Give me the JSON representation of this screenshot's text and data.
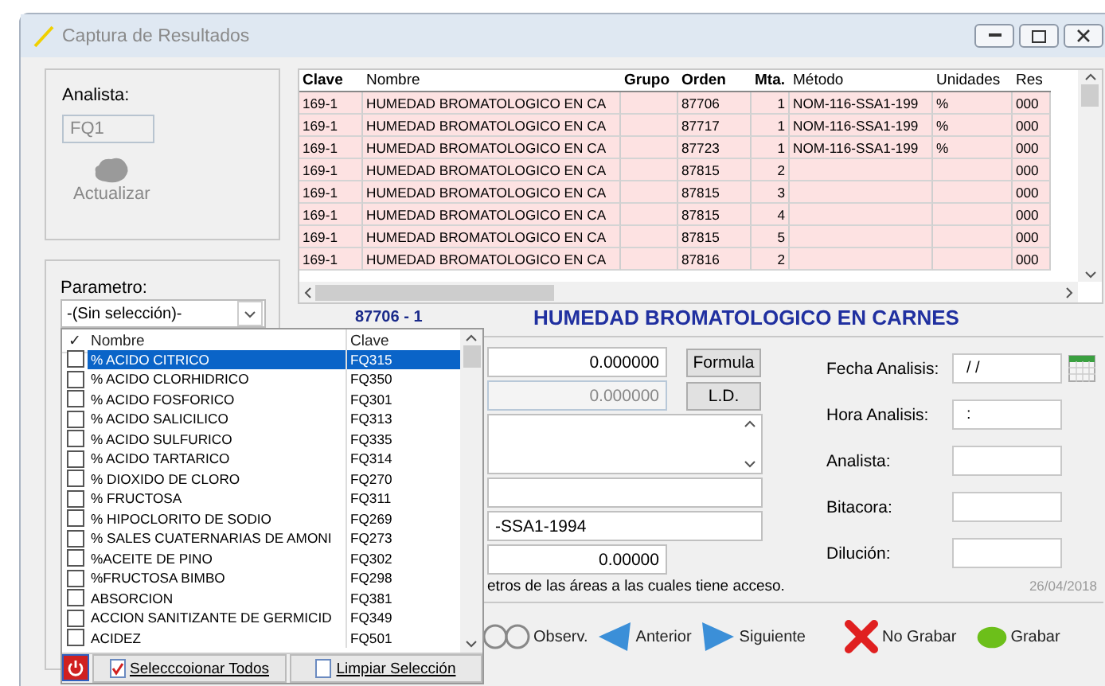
{
  "window": {
    "title": "Captura de Resultados"
  },
  "analista_panel": {
    "label": "Analista:",
    "value": "FQ1",
    "disabled": true,
    "refresh_label": "Actualizar",
    "refresh_disabled": true
  },
  "parametro_panel": {
    "label": "Parametro:",
    "value": "-(Sin selección)-"
  },
  "results_grid": {
    "columns": [
      "Clave",
      "Nombre",
      "Grupo",
      "Orden",
      "Mta.",
      "Método",
      "Unidades",
      "Res"
    ],
    "rows": [
      {
        "cells": [
          "169-1",
          "HUMEDAD BROMATOLOGICO EN CA",
          "",
          "87706",
          "1",
          "NOM-116-SSA1-199",
          "%",
          "000"
        ]
      },
      {
        "cells": [
          "169-1",
          "HUMEDAD BROMATOLOGICO EN CA",
          "",
          "87717",
          "1",
          "NOM-116-SSA1-199",
          "%",
          "000"
        ]
      },
      {
        "cells": [
          "169-1",
          "HUMEDAD BROMATOLOGICO EN CA",
          "",
          "87723",
          "1",
          "NOM-116-SSA1-199",
          "%",
          "000"
        ]
      },
      {
        "cells": [
          "169-1",
          "HUMEDAD BROMATOLOGICO EN CA",
          "",
          "87815",
          "2",
          "",
          "",
          "000"
        ]
      },
      {
        "cells": [
          "169-1",
          "HUMEDAD BROMATOLOGICO EN CA",
          "",
          "87815",
          "3",
          "",
          "",
          "000"
        ]
      },
      {
        "cells": [
          "169-1",
          "HUMEDAD BROMATOLOGICO EN CA",
          "",
          "87815",
          "4",
          "",
          "",
          "000"
        ]
      },
      {
        "cells": [
          "169-1",
          "HUMEDAD BROMATOLOGICO EN CA",
          "",
          "87815",
          "5",
          "",
          "",
          "000"
        ]
      },
      {
        "cells": [
          "169-1",
          "HUMEDAD BROMATOLOGICO EN CA",
          "",
          "87816",
          "2",
          "",
          "",
          "000"
        ]
      }
    ]
  },
  "detail": {
    "code": "87706 - 1",
    "title": "HUMEDAD BROMATOLOGICO EN CARNES",
    "fields": [
      {
        "kind": "number",
        "value": "0.000000",
        "disabled": false,
        "button": "Formula"
      },
      {
        "kind": "number",
        "value": "0.000000",
        "disabled": true,
        "button": "L.D."
      },
      {
        "kind": "memo"
      },
      {
        "kind": "text"
      },
      {
        "kind": "text",
        "value": "-SSA1-1994"
      },
      {
        "kind": "number",
        "value": "0.00000",
        "disabled": false
      }
    ],
    "side_fields": [
      {
        "label": "Fecha Analisis:",
        "value": "/ /"
      },
      {
        "label": "Hora Analisis:",
        "value": ":"
      },
      {
        "label": "Analista:"
      },
      {
        "label": "Bitacora:"
      },
      {
        "label": "Dilución:"
      }
    ],
    "status": "etros de las áreas a las cuales tiene acceso.",
    "date": "26/04/2018"
  },
  "toolbar": [
    {
      "kind": "observe",
      "label": "Observ."
    },
    {
      "kind": "previous",
      "label": "Anterior"
    },
    {
      "kind": "next",
      "label": "Siguiente"
    },
    {
      "kind": "cancel",
      "label": "No Grabar"
    },
    {
      "kind": "save",
      "label": "Grabar"
    }
  ],
  "parameter_dropdown": {
    "check_header": "✓",
    "columns": [
      "Nombre",
      "Clave"
    ],
    "items": [
      {
        "name": "% ACIDO CITRICO",
        "clave": "FQ315",
        "checked": false,
        "selected": true
      },
      {
        "name": "% ACIDO CLORHIDRICO",
        "clave": "FQ350",
        "checked": false,
        "selected": false
      },
      {
        "name": "% ACIDO FOSFORICO",
        "clave": "FQ301",
        "checked": false,
        "selected": false
      },
      {
        "name": "% ACIDO SALICILICO",
        "clave": "FQ313",
        "checked": false,
        "selected": false
      },
      {
        "name": "% ACIDO SULFURICO",
        "clave": "FQ335",
        "checked": false,
        "selected": false
      },
      {
        "name": "% ACIDO TARTARICO",
        "clave": "FQ314",
        "checked": false,
        "selected": false
      },
      {
        "name": "% DIOXIDO DE CLORO",
        "clave": "FQ270",
        "checked": false,
        "selected": false
      },
      {
        "name": "% FRUCTOSA",
        "clave": "FQ311",
        "checked": false,
        "selected": false
      },
      {
        "name": "% HIPOCLORITO  DE SODIO",
        "clave": "FQ269",
        "checked": false,
        "selected": false
      },
      {
        "name": "% SALES CUATERNARIAS DE AMONI",
        "clave": "FQ273",
        "checked": false,
        "selected": false
      },
      {
        "name": "%ACEITE DE PINO",
        "clave": "FQ302",
        "checked": false,
        "selected": false
      },
      {
        "name": "%FRUCTOSA BIMBO",
        "clave": "FQ298",
        "checked": false,
        "selected": false
      },
      {
        "name": "ABSORCION",
        "clave": "FQ381",
        "checked": false,
        "selected": false
      },
      {
        "name": "ACCION SANITIZANTE DE GERMICID",
        "clave": "FQ349",
        "checked": false,
        "selected": false
      },
      {
        "name": "ACIDEZ",
        "clave": "FQ501",
        "checked": false,
        "selected": false
      }
    ],
    "buttons": [
      "Selecccoionar Todos",
      "Limpiar Selección"
    ]
  }
}
